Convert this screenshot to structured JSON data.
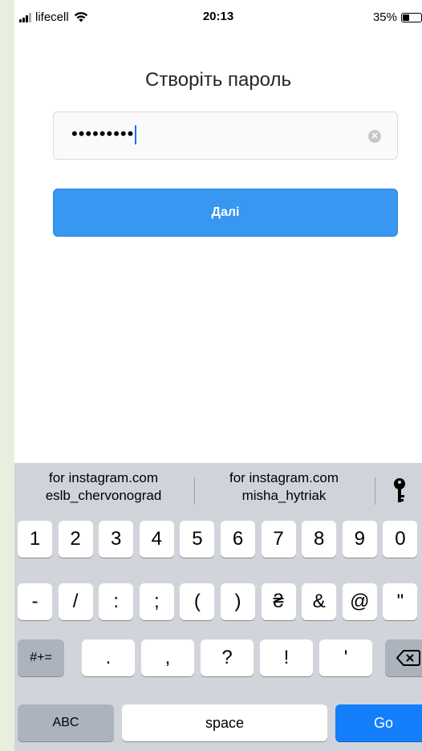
{
  "status_bar": {
    "carrier": "lifecell",
    "time": "20:13",
    "battery": "35%",
    "battery_level": 0.35
  },
  "screen": {
    "title": "Створіть пароль",
    "password_value": "•••••••••",
    "next_label": "Далі"
  },
  "keyboard": {
    "suggestions": [
      {
        "line1": "for instagram.com",
        "line2": "eslb_chervonograd"
      },
      {
        "line1": "for instagram.com",
        "line2": "misha_hytriak"
      }
    ],
    "row1": [
      "1",
      "2",
      "3",
      "4",
      "5",
      "6",
      "7",
      "8",
      "9",
      "0"
    ],
    "row2": [
      "-",
      "/",
      ":",
      ";",
      "(",
      ")",
      "₴",
      "&",
      "@",
      "\""
    ],
    "row3": [
      ".",
      ",",
      "?",
      "!",
      "'"
    ],
    "symbols_label": "#+=",
    "abc_label": "ABC",
    "space_label": "space",
    "go_label": "Go"
  }
}
